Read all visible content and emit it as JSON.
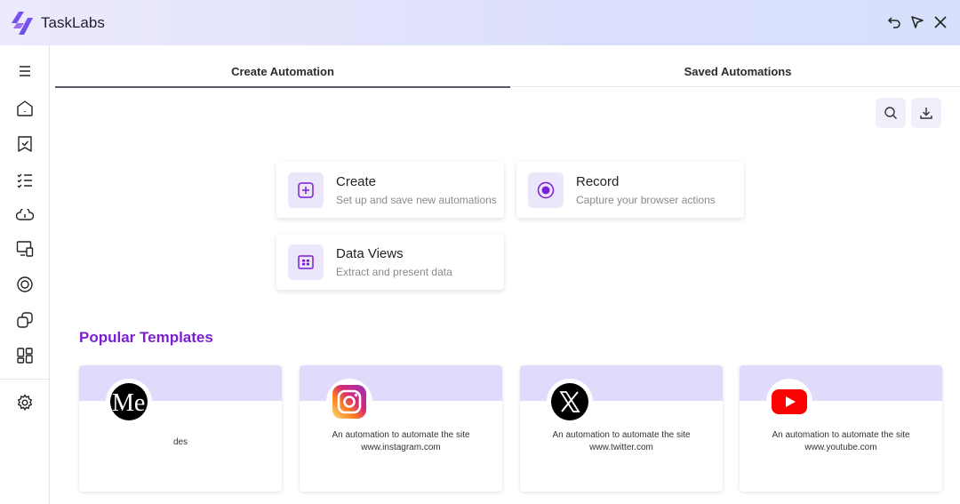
{
  "app": {
    "title": "TaskLabs"
  },
  "tabs": [
    {
      "label": "Create Automation"
    },
    {
      "label": "Saved Automations"
    }
  ],
  "actions": [
    {
      "title": "Create",
      "subtitle": "Set up and save new automations",
      "icon": "plus-square-icon"
    },
    {
      "title": "Record",
      "subtitle": "Capture your browser actions",
      "icon": "record-icon"
    },
    {
      "title": "Data Views",
      "subtitle": "Extract and present data",
      "icon": "grid-view-icon"
    }
  ],
  "popular": {
    "title": "Popular Templates",
    "templates": [
      {
        "site": "medium",
        "desc": "des"
      },
      {
        "site": "instagram",
        "desc": "An automation to automate the site www.instagram.com"
      },
      {
        "site": "x",
        "desc": "An automation to automate the site www.twitter.com"
      },
      {
        "site": "youtube",
        "desc": "An automation to automate the site www.youtube.com"
      }
    ]
  },
  "colors": {
    "accent": "#7b1fd3",
    "icon_bg": "#ece6fb",
    "band": "#e2dafa"
  }
}
